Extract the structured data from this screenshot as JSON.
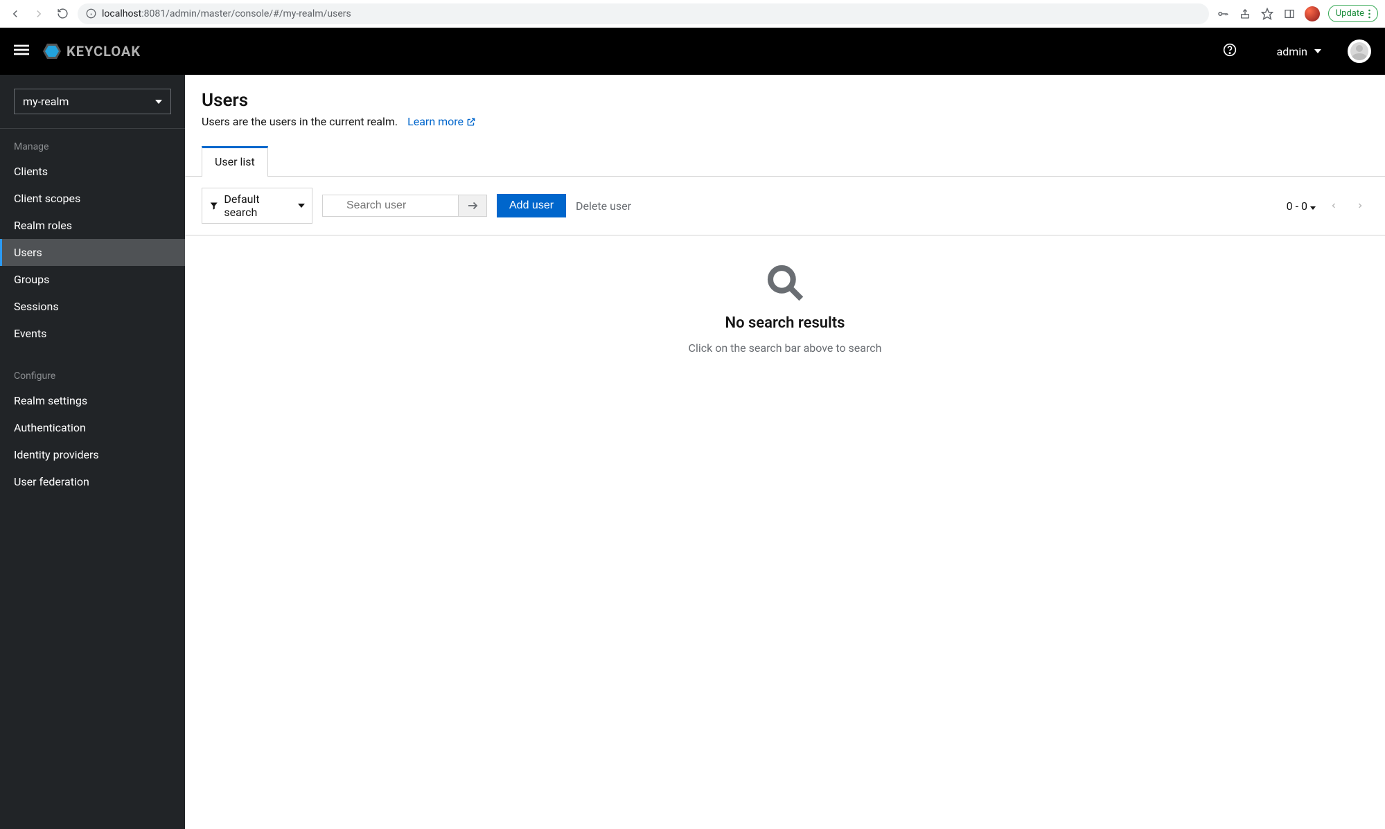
{
  "browser": {
    "url_host": "localhost",
    "url_rest": ":8081/admin/master/console/#/my-realm/users",
    "update_label": "Update"
  },
  "header": {
    "brand": "KEYCLOAK",
    "username": "admin"
  },
  "sidebar": {
    "realm": "my-realm",
    "section_manage": "Manage",
    "section_configure": "Configure",
    "manage_items": [
      {
        "label": "Clients"
      },
      {
        "label": "Client scopes"
      },
      {
        "label": "Realm roles"
      },
      {
        "label": "Users"
      },
      {
        "label": "Groups"
      },
      {
        "label": "Sessions"
      },
      {
        "label": "Events"
      }
    ],
    "configure_items": [
      {
        "label": "Realm settings"
      },
      {
        "label": "Authentication"
      },
      {
        "label": "Identity providers"
      },
      {
        "label": "User federation"
      }
    ]
  },
  "page": {
    "title": "Users",
    "description": "Users are the users in the current realm.",
    "learn_more": "Learn more"
  },
  "tabs": {
    "user_list": "User list"
  },
  "toolbar": {
    "filter_label": "Default search",
    "search_placeholder": "Search user",
    "add_user": "Add user",
    "delete_user": "Delete user",
    "pager_range": "0 - 0"
  },
  "empty": {
    "title": "No search results",
    "subtitle": "Click on the search bar above to search"
  }
}
